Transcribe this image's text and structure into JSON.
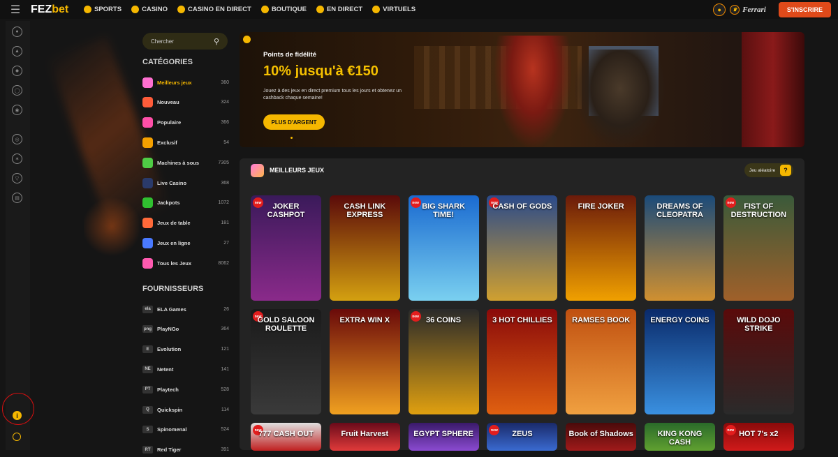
{
  "header": {
    "logo_a": "FEZ",
    "logo_b": "bet",
    "nav": [
      {
        "label": "SPORTS",
        "icon": "soccer-ball-icon"
      },
      {
        "label": "CASINO",
        "icon": "casino-chip-icon"
      },
      {
        "label": "CASINO EN DIRECT",
        "icon": "roulette-icon"
      },
      {
        "label": "BOUTIQUE",
        "icon": "shop-icon"
      },
      {
        "label": "EN DIRECT",
        "icon": "live-icon"
      },
      {
        "label": "VIRTUELS",
        "icon": "virtual-icon"
      }
    ],
    "partner": "Ferrari",
    "signup_label": "S'INSCRIRE"
  },
  "sidebar": {
    "search_placeholder": "Chercher",
    "categories_title": "CATÉGORIES",
    "categories": [
      {
        "label": "Meilleurs jeux",
        "count": "360",
        "color": "#ff6fd0"
      },
      {
        "label": "Nouveau",
        "count": "324",
        "color": "#ff5c3a"
      },
      {
        "label": "Populaire",
        "count": "366",
        "color": "#ff4fa8"
      },
      {
        "label": "Exclusif",
        "count": "54",
        "color": "#f5a000"
      },
      {
        "label": "Machines à sous",
        "count": "7305",
        "color": "#4fcc45"
      },
      {
        "label": "Live Casino",
        "count": "368",
        "color": "#2a3a6a"
      },
      {
        "label": "Jackpots",
        "count": "1072",
        "color": "#30c030"
      },
      {
        "label": "Jeux de table",
        "count": "181",
        "color": "#ff6a3a"
      },
      {
        "label": "Jeux en ligne",
        "count": "27",
        "color": "#4a7aff"
      },
      {
        "label": "Tous les Jeux",
        "count": "8062",
        "color": "#ff5ab0"
      }
    ],
    "providers_title": "FOURNISSEURS",
    "providers": [
      {
        "label": "ELA Games",
        "count": "26",
        "abbr": "ela"
      },
      {
        "label": "PlayNGo",
        "count": "364",
        "abbr": "png"
      },
      {
        "label": "Evolution",
        "count": "121",
        "abbr": "E"
      },
      {
        "label": "Netent",
        "count": "141",
        "abbr": "NE"
      },
      {
        "label": "Playtech",
        "count": "528",
        "abbr": "PT"
      },
      {
        "label": "Quickspin",
        "count": "114",
        "abbr": "Q"
      },
      {
        "label": "Spinomenal",
        "count": "524",
        "abbr": "S"
      },
      {
        "label": "Red Tiger",
        "count": "391",
        "abbr": "RT"
      }
    ]
  },
  "banner": {
    "subtitle": "Points de fidélité",
    "headline": "10% jusqu'à €150",
    "description": "Jouez à des jeux en direct premium tous les jours et obtenez un cashback chaque semaine!",
    "button": "PLUS D'ARGENT"
  },
  "games": {
    "title": "MEILLEURS JEUX",
    "random_label": "Jeu aléatoire",
    "tiles": [
      {
        "title": "JOKER CASHPOT",
        "new": true,
        "bg": "#3a1a5a",
        "bg2": "#8a2a8a"
      },
      {
        "title": "CASH LINK EXPRESS",
        "new": false,
        "bg": "#5a0a0a",
        "bg2": "#d4a010"
      },
      {
        "title": "BIG SHARK TIME!",
        "new": true,
        "bg": "#1a6ad0",
        "bg2": "#7ad0f0"
      },
      {
        "title": "CASH OF GODS",
        "new": true,
        "bg": "#2a4a8a",
        "bg2": "#d0a030"
      },
      {
        "title": "FIRE JOKER",
        "new": false,
        "bg": "#6a1a0a",
        "bg2": "#f0a000"
      },
      {
        "title": "DREAMS OF CLEOPATRA",
        "new": false,
        "bg": "#1a4a7a",
        "bg2": "#d09030"
      },
      {
        "title": "FIST OF DESTRUCTION",
        "new": true,
        "bg": "#3a5a3a",
        "bg2": "#a0602a"
      },
      {
        "title": "GOLD SALOON ROULETTE",
        "new": true,
        "bg": "#1a1a1a",
        "bg2": "#3a3a3a"
      },
      {
        "title": "EXTRA WIN X",
        "new": false,
        "bg": "#6a0a0a",
        "bg2": "#f0a020"
      },
      {
        "title": "36 COINS",
        "new": true,
        "bg": "#2a2a2a",
        "bg2": "#e0a010"
      },
      {
        "title": "3 HOT CHILLIES",
        "new": false,
        "bg": "#8a0a0a",
        "bg2": "#e06010"
      },
      {
        "title": "RAMSES BOOK",
        "new": false,
        "bg": "#c05010",
        "bg2": "#f0a040"
      },
      {
        "title": "ENERGY COINS",
        "new": false,
        "bg": "#0a2a6a",
        "bg2": "#3a90e0"
      },
      {
        "title": "WILD DOJO STRIKE",
        "new": false,
        "bg": "#5a0a0a",
        "bg2": "#2a2a2a"
      },
      {
        "title": "777 CASH OUT",
        "new": true,
        "bg": "#e0e0e0",
        "bg2": "#c02020"
      },
      {
        "title": "Fruit Harvest",
        "new": false,
        "bg": "#6a0a1a",
        "bg2": "#e03a3a"
      },
      {
        "title": "EGYPT SPHERE",
        "new": false,
        "bg": "#3a1a6a",
        "bg2": "#8a4ad0"
      },
      {
        "title": "ZEUS",
        "new": true,
        "bg": "#1a2a6a",
        "bg2": "#3a6ad0"
      },
      {
        "title": "Book of Shadows",
        "new": false,
        "bg": "#4a0a0a",
        "bg2": "#a01a1a"
      },
      {
        "title": "KING KONG CASH",
        "new": false,
        "bg": "#2a6a2a",
        "bg2": "#60a030"
      },
      {
        "title": "HOT 7's x2",
        "new": true,
        "bg": "#8a0a0a",
        "bg2": "#d01a1a"
      }
    ]
  }
}
